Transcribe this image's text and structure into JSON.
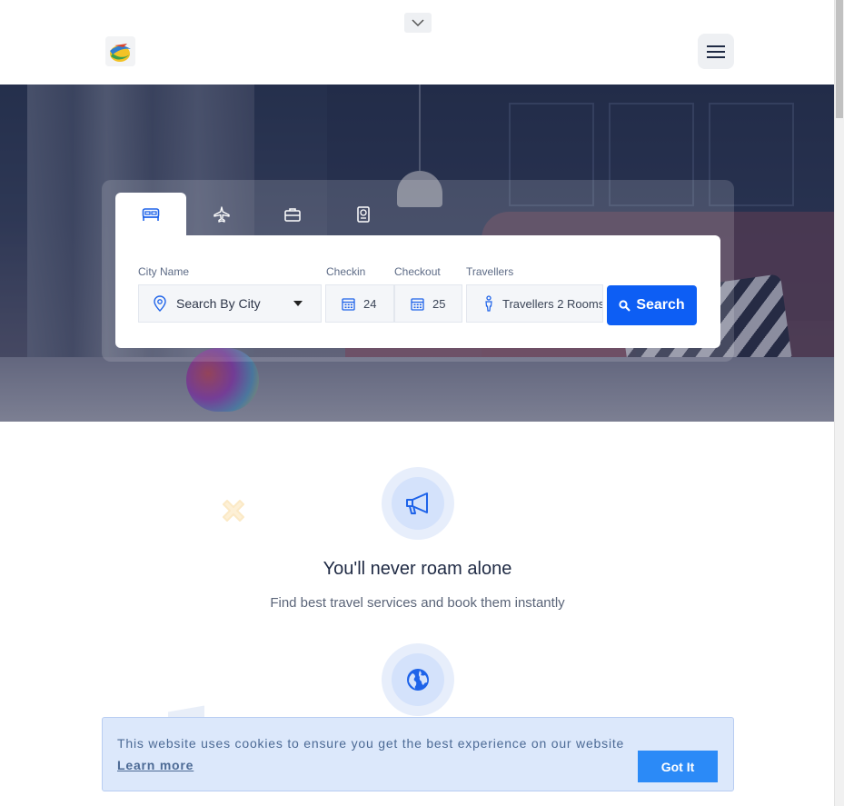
{
  "header": {
    "logo_alt": "",
    "menu_icon": "hamburger-menu-icon",
    "collapse_icon": "chevron-down-icon"
  },
  "search": {
    "tabs": [
      {
        "id": "hotels",
        "icon": "bed-icon",
        "active": true
      },
      {
        "id": "flights",
        "icon": "airplane-icon",
        "active": false
      },
      {
        "id": "tours",
        "icon": "briefcase-icon",
        "active": false
      },
      {
        "id": "visa",
        "icon": "passport-icon",
        "active": false
      }
    ],
    "city_label": "City Name",
    "city_placeholder": "Search By City",
    "checkin_label": "Checkin",
    "checkin_value": "24",
    "checkout_label": "Checkout",
    "checkout_value": "25",
    "travellers_label": "Travellers",
    "travellers_value": "Travellers 2 Rooms",
    "search_button": "Search"
  },
  "features": [
    {
      "icon": "megaphone-icon",
      "title": "You'll never roam alone",
      "desc": "Find best travel services and book them instantly"
    },
    {
      "icon": "globe-icon",
      "title": "",
      "desc": ""
    }
  ],
  "cookie": {
    "message": "This website uses cookies to ensure you get the best experience on our website",
    "learn_more": "Learn more",
    "button": "Got It"
  },
  "colors": {
    "accent": "#0d5ef4",
    "cookie_bg": "#dce8fb",
    "cookie_button": "#2b8af7"
  }
}
